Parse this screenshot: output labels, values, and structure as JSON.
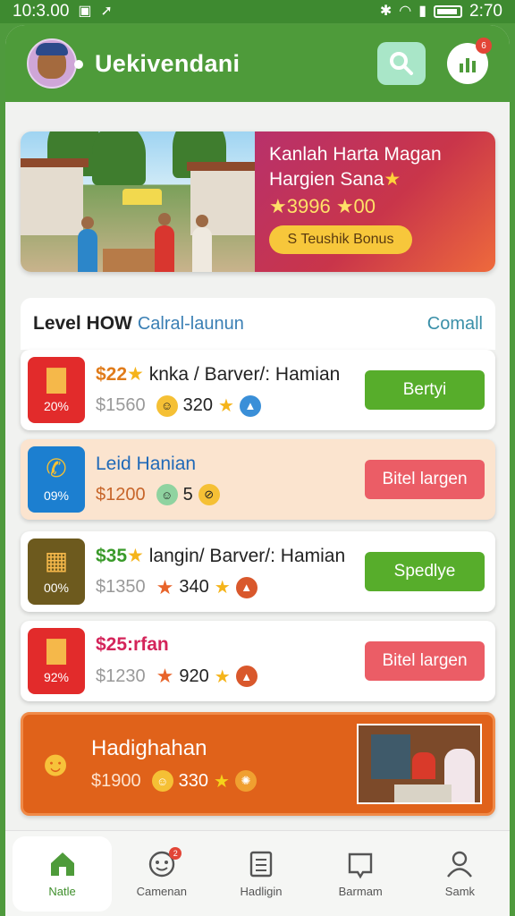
{
  "status_bar": {
    "time": "10:3.00",
    "right_time": "2:70"
  },
  "header": {
    "title": "Uekivendani",
    "badge": "6"
  },
  "banner": {
    "title_line1": "Kanlah Harta Magan",
    "title_line2": "Hargien Sana",
    "amount": "3996",
    "amount_suffix": "00",
    "button": "S Teushik Bonus"
  },
  "level": {
    "title": "Level HOW",
    "subtitle": "Calral-launun",
    "link": "Comall"
  },
  "offers": [
    {
      "price": "$22",
      "title": "knka / Barver/: Hamian",
      "old_price": "$1560",
      "count": "320",
      "pct": "20%",
      "button": "Bertyi",
      "icon": "bucket-icon",
      "color": "#e22b2b"
    },
    {
      "price": "",
      "title": "Leid Hanian",
      "old_price": "$1200",
      "count": "5",
      "pct": "09%",
      "button": "Bitel largen",
      "icon": "phone-icon",
      "color": "#1c7fd0"
    },
    {
      "price": "$35",
      "title": "langin/ Barver/: Hamian",
      "old_price": "$1350",
      "count": "340",
      "pct": "00%",
      "button": "Spedlye",
      "icon": "gift-box-icon",
      "color": "#6d5a1e"
    },
    {
      "price": "$25:rfan",
      "title": "",
      "old_price": "$1230",
      "count": "920",
      "pct": "92%",
      "button": "Bitel largen",
      "icon": "bucket-icon",
      "color": "#e22b2b"
    },
    {
      "price": "",
      "title": "Hadighahan",
      "old_price": "$1900",
      "count": "330",
      "pct": "",
      "button": "",
      "icon": "smiley-icon",
      "color": "#e0621a"
    }
  ],
  "nav": [
    {
      "label": "Natle",
      "icon": "home-icon"
    },
    {
      "label": "Camenan",
      "icon": "chat-icon",
      "badge": "2"
    },
    {
      "label": "Hadligin",
      "icon": "list-icon"
    },
    {
      "label": "Barmam",
      "icon": "bookmark-icon"
    },
    {
      "label": "Samk",
      "icon": "profile-icon"
    }
  ],
  "colors": {
    "header_green": "#4e9b3a",
    "button_green": "#57ad2b",
    "button_red": "#eb5d66",
    "featured_orange": "#e0621a"
  }
}
